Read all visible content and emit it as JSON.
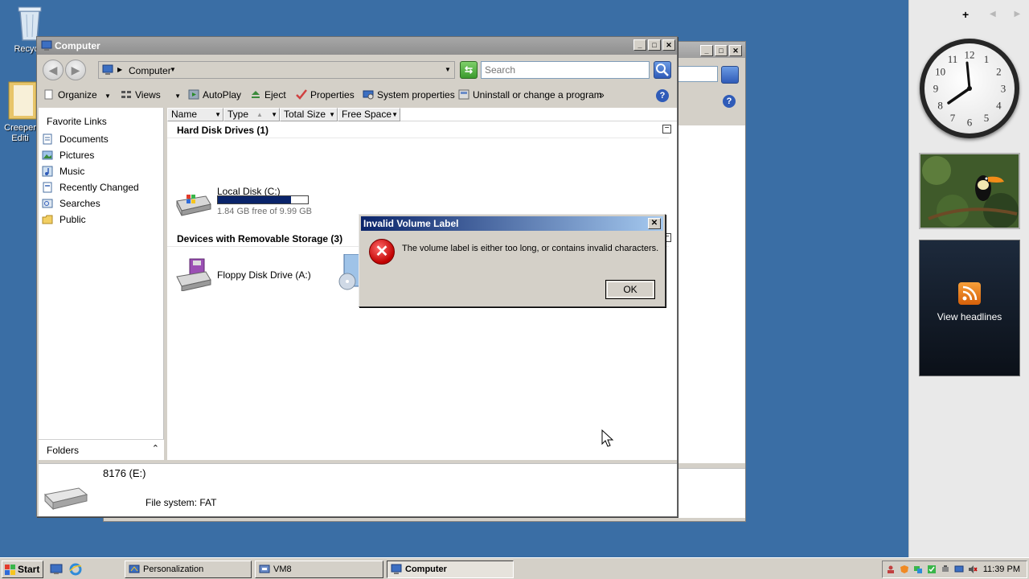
{
  "desktop": {
    "icons": [
      {
        "label": "Recycle",
        "icon": "recycle-bin-icon"
      },
      {
        "label": "Creeper Editi",
        "icon": "folder-icon"
      }
    ]
  },
  "sidebar": {
    "add_glyph": "+",
    "nav_arrows": "◀ ▶",
    "clock_numbers": [
      "12",
      "1",
      "2",
      "3",
      "4",
      "5",
      "6",
      "7",
      "8",
      "9",
      "10",
      "11"
    ],
    "feed_label": "View headlines"
  },
  "window": {
    "title": "Computer",
    "address": "Computer",
    "search_placeholder": "Search",
    "toolbar": {
      "organize": "Organize",
      "views": "Views",
      "autoplay": "AutoPlay",
      "eject": "Eject",
      "properties": "Properties",
      "system_properties": "System properties",
      "uninstall": "Uninstall or change a program",
      "more": "»"
    },
    "favorite_links_title": "Favorite Links",
    "favorites": [
      "Documents",
      "Pictures",
      "Music",
      "Recently Changed",
      "Searches",
      "Public"
    ],
    "folders_label": "Folders",
    "columns": [
      "Name",
      "Type",
      "Total Size",
      "Free Space"
    ],
    "groups": {
      "hard_disk": "Hard Disk Drives (1)",
      "removable": "Devices with Removable Storage (3)"
    },
    "drives": {
      "local_disk": {
        "name": "Local Disk (C:)",
        "free_text": "1.84 GB free of 9.99 GB",
        "used_fraction": 0.816
      },
      "floppy": {
        "name": "Floppy Disk Drive (A:)"
      }
    },
    "details": {
      "name": "8176 (E:)",
      "file_system": "File system: FAT"
    }
  },
  "dialog": {
    "title": "Invalid Volume Label",
    "message": "The volume label is either too long, or contains invalid characters.",
    "ok_label": "OK",
    "close_glyph": "✕",
    "error_glyph": "✕"
  },
  "taskbar": {
    "start_label": "Start",
    "tasks": [
      {
        "label": "Personalization",
        "active": false
      },
      {
        "label": "VM8",
        "active": false
      },
      {
        "label": "Computer",
        "active": true
      }
    ],
    "time": "11:39 PM"
  },
  "colors": {
    "desktop": "#3a6ea5",
    "title_active_start": "#0a246a",
    "title_active_end": "#a6caf0",
    "drive_fill": "#0a246a",
    "error_red": "#c00000"
  }
}
